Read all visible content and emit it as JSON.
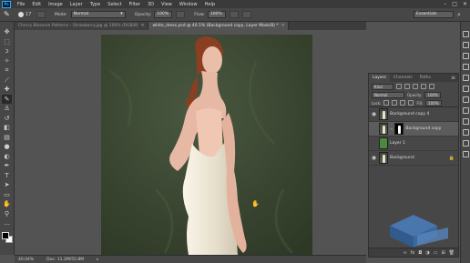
{
  "menubar": {
    "logo": "Ps",
    "items": [
      "File",
      "Edit",
      "Image",
      "Layer",
      "Type",
      "Select",
      "Filter",
      "3D",
      "View",
      "Window",
      "Help"
    ],
    "window_controls": [
      "–",
      "□",
      "✕"
    ]
  },
  "options": {
    "brush_size": "17",
    "mode_label": "Mode:",
    "mode_value": "Normal",
    "opacity_label": "Opacity:",
    "opacity_value": "100%",
    "flow_label": "Flow:",
    "flow_value": "100%",
    "workspace": "Essentials"
  },
  "tabs": [
    {
      "label": "Cherry Blossom Patterns - Strawberry.jpg @ 100% (RGB/8)",
      "active": false
    },
    {
      "label": "white_dress.psd @ 40.1% (Background copy, Layer Mask/8) *",
      "active": true
    }
  ],
  "status": {
    "zoom": "40.04%",
    "doc": "Doc: 11.2M/55.8M"
  },
  "layers_panel": {
    "tabs": [
      "Layers",
      "Channels",
      "Paths"
    ],
    "filter_kind": "Kind",
    "blend_mode": "Normal",
    "opacity_label": "Opacity:",
    "opacity_value": "100%",
    "lock_label": "Lock:",
    "fill_label": "Fill:",
    "fill_value": "100%",
    "layers": [
      {
        "name": "Background copy 4",
        "visible": true,
        "selected": false
      },
      {
        "name": "Background copy",
        "visible": false,
        "selected": true
      },
      {
        "name": "Layer 1",
        "visible": false,
        "selected": false
      },
      {
        "name": "Background",
        "visible": true,
        "selected": false
      }
    ]
  },
  "colors": {
    "backdrop": "#3e4a34",
    "dress": "#ece6d6",
    "skin": "#e7b9a4",
    "hair": "#8a3e22"
  }
}
